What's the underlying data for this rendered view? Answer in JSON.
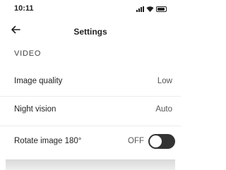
{
  "status_bar": {
    "time": "10:11",
    "icons": [
      "signal-icon",
      "wifi-icon",
      "battery-icon"
    ]
  },
  "header": {
    "title": "Settings",
    "back_icon": "back-arrow-icon"
  },
  "section": {
    "title": "VIDEO"
  },
  "settings": {
    "image_quality": {
      "label": "Image quality",
      "value": "Low"
    },
    "night_vision": {
      "label": "Night vision",
      "value": "Auto"
    },
    "rotate_image": {
      "label": "Rotate image 180°",
      "state": "OFF",
      "enabled": false
    }
  },
  "colors": {
    "toggle_off": "#333333",
    "divider": "#ececec",
    "text": "#1f1f1f"
  }
}
